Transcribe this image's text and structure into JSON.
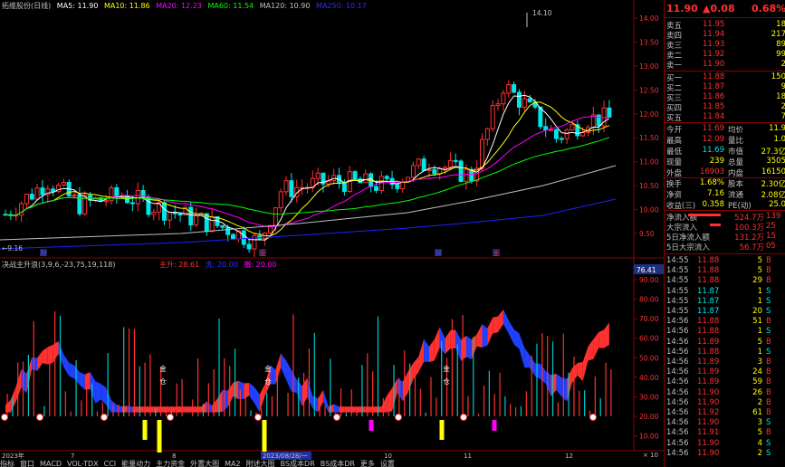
{
  "colors": {
    "up": "#ff3030",
    "down": "#00e5e5",
    "ma5": "#ffffff",
    "ma10": "#ffff00",
    "ma20": "#ff00ff",
    "ma60": "#00ff00",
    "ma120": "#c0c0c0",
    "ma250": "#2020ff"
  },
  "header": {
    "title": "拓维股份(日线)",
    "ma5": "MA5: 11.90",
    "ma10": "MA10: 11.86",
    "ma20": "MA20: 12.23",
    "ma60": "MA60: 11.54",
    "ma120": "MA120: 10.90",
    "ma250": "MA250: 10.17"
  },
  "price_axis": [
    "14.00",
    "13.50",
    "13.00",
    "12.50",
    "12.00",
    "11.50",
    "11.00",
    "10.50",
    "10.00",
    "9.50"
  ],
  "price_marks": {
    "high": "14.10",
    "low": "9.16"
  },
  "event_marks": [
    "财",
    "业",
    "财",
    "业"
  ],
  "indicator": {
    "name": "决战主升浪(3,9,6,-23,75,19,118)",
    "l1": "主升: 28.61",
    "l2": "洗: 20.00",
    "l3": "撤: 20.00",
    "current": "76.41",
    "axis": [
      "90.00",
      "80.00",
      "70.00",
      "60.00",
      "50.00",
      "40.00",
      "30.00",
      "20.00",
      "10.00"
    ],
    "markers": [
      "金仓",
      "金仓",
      "金仓"
    ],
    "x_axis_unit": "× 10"
  },
  "date_axis": [
    "2023年",
    "7",
    "8",
    "2023/08/28/一",
    "10",
    "11",
    "12"
  ],
  "bottom_tabs": [
    "指标",
    "窗口",
    "MACD",
    "VOL-TDX",
    "CCI",
    "能量动力",
    "主力资金",
    "外置大图",
    "MA2",
    "附述大图",
    "BS成本DR",
    "BS成本DR",
    "更多",
    "设置"
  ],
  "quote": {
    "price": "11.90",
    "change": "▲0.08",
    "pct": "0.68%",
    "asks": [
      {
        "label": "卖五",
        "price": "11.95",
        "vol": "18"
      },
      {
        "label": "卖四",
        "price": "11.94",
        "vol": "217"
      },
      {
        "label": "卖三",
        "price": "11.93",
        "vol": "89"
      },
      {
        "label": "卖二",
        "price": "11.92",
        "vol": "99"
      },
      {
        "label": "卖一",
        "price": "11.90",
        "vol": "2"
      }
    ],
    "bids": [
      {
        "label": "买一",
        "price": "11.88",
        "vol": "150"
      },
      {
        "label": "买二",
        "price": "11.87",
        "vol": "9"
      },
      {
        "label": "买三",
        "price": "11.86",
        "vol": "18"
      },
      {
        "label": "买四",
        "price": "11.85",
        "vol": "2"
      },
      {
        "label": "买五",
        "price": "11.84",
        "vol": "7"
      }
    ],
    "stats": [
      {
        "l1": "今开",
        "v1": "11.69",
        "l2": "均价",
        "v2": "11.9"
      },
      {
        "l1": "最高",
        "v1": "12.09",
        "l2": "量比",
        "v2": "1.0"
      },
      {
        "l1": "最低",
        "v1": "11.69",
        "l2": "市值",
        "v2": "27.3亿"
      },
      {
        "l1": "现量",
        "v1": "239",
        "l2": "总量",
        "v2": "3505"
      },
      {
        "l1": "外盘",
        "v1": "16903",
        "l2": "内盘",
        "v2": "16150"
      },
      {
        "l1": "换手",
        "v1": "1.68%",
        "l2": "股本",
        "v2": "2.30亿"
      },
      {
        "l1": "净资",
        "v1": "7.16",
        "l2": "流通",
        "v2": "2.08亿"
      },
      {
        "l1": "收益(三)",
        "v1": "0.358",
        "l2": "PE(动)",
        "v2": "25.0"
      }
    ],
    "flows": [
      {
        "label": "净流入额",
        "value": "524.7万",
        "extra": "139"
      },
      {
        "label": "大宗流入",
        "value": "100.3万",
        "extra": "25"
      },
      {
        "label": "5日净流入额",
        "value": "131.2万",
        "extra": "15"
      },
      {
        "label": "5日大宗流入",
        "value": "56.7万",
        "extra": "05"
      }
    ],
    "ticks": [
      {
        "t": "14:55",
        "p": "11.88",
        "v": "5",
        "d": "B"
      },
      {
        "t": "14:55",
        "p": "11.88",
        "v": "5",
        "d": "B"
      },
      {
        "t": "14:55",
        "p": "11.88",
        "v": "29",
        "d": "B"
      },
      {
        "t": "14:55",
        "p": "11.87",
        "v": "1",
        "d": "S"
      },
      {
        "t": "14:55",
        "p": "11.87",
        "v": "1",
        "d": "S"
      },
      {
        "t": "14:55",
        "p": "11.87",
        "v": "20",
        "d": "S"
      },
      {
        "t": "14:56",
        "p": "11.88",
        "v": "51",
        "d": "B"
      },
      {
        "t": "14:56",
        "p": "11.88",
        "v": "1",
        "d": "S"
      },
      {
        "t": "14:56",
        "p": "11.89",
        "v": "5",
        "d": "B"
      },
      {
        "t": "14:56",
        "p": "11.88",
        "v": "1",
        "d": "S"
      },
      {
        "t": "14:56",
        "p": "11.89",
        "v": "3",
        "d": "B"
      },
      {
        "t": "14:56",
        "p": "11.89",
        "v": "24",
        "d": "B"
      },
      {
        "t": "14:56",
        "p": "11.89",
        "v": "59",
        "d": "B"
      },
      {
        "t": "14:56",
        "p": "11.90",
        "v": "26",
        "d": "B"
      },
      {
        "t": "14:56",
        "p": "11.90",
        "v": "2",
        "d": "B"
      },
      {
        "t": "14:56",
        "p": "11.92",
        "v": "61",
        "d": "B"
      },
      {
        "t": "14:56",
        "p": "11.90",
        "v": "3",
        "d": "S"
      },
      {
        "t": "14:56",
        "p": "11.91",
        "v": "5",
        "d": "B"
      },
      {
        "t": "14:56",
        "p": "11.90",
        "v": "4",
        "d": "S"
      },
      {
        "t": "14:56",
        "p": "11.90",
        "v": "2",
        "d": "S"
      }
    ]
  }
}
